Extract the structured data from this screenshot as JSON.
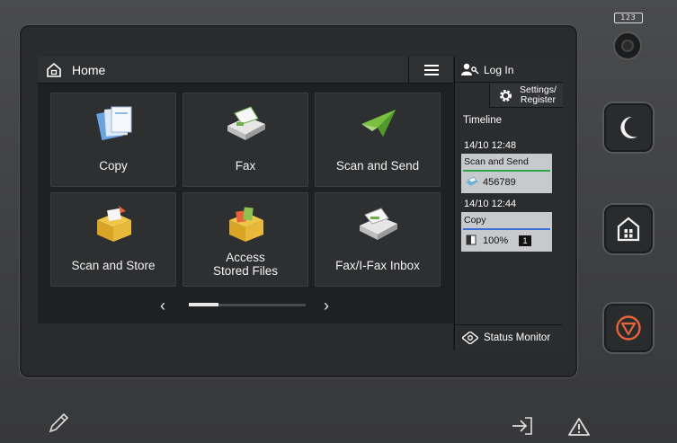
{
  "header": {
    "title": "Home"
  },
  "tiles": [
    {
      "label": "Copy",
      "icon": "copy-icon"
    },
    {
      "label": "Fax",
      "icon": "fax-icon"
    },
    {
      "label": "Scan and Send",
      "icon": "scan-send-icon"
    },
    {
      "label": "Scan and Store",
      "icon": "scan-store-icon"
    },
    {
      "label_line1": "Access",
      "label_line2": "Stored Files",
      "icon": "stored-files-icon"
    },
    {
      "label": "Fax/I-Fax Inbox",
      "icon": "fax-inbox-icon"
    }
  ],
  "pager": {
    "current_page": 1,
    "total_pages": 4
  },
  "right_panel": {
    "login_label": "Log In",
    "settings_label_line1": "Settings/",
    "settings_label_line2": "Register",
    "timeline_title": "Timeline",
    "jobs": [
      {
        "timestamp": "14/10 12:48",
        "name": "Scan and Send",
        "value": "456789",
        "bar_color": "#2aa34a"
      },
      {
        "timestamp": "14/10 12:44",
        "name": "Copy",
        "value": "100%",
        "badge": "1",
        "bar_color": "#3a6fd8"
      }
    ],
    "status_monitor_label": "Status Monitor"
  },
  "hardware": {
    "keypad_label": "123"
  },
  "colors": {
    "screen_bg": "#1f2022",
    "tile_bg": "#2e2f31",
    "stop_orange": "#e8623a"
  }
}
